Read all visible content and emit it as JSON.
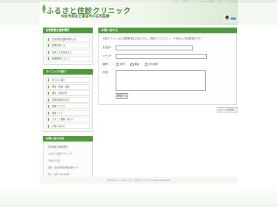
{
  "header": {
    "note": "ふるさと住診クリニックは仙台市泉区と富谷市の在宅医療",
    "title": "ふるさと住診クリニック",
    "subtitle": "仙台市泉区と富谷市の在宅医療",
    "logo_icon": "logo-character-icon"
  },
  "sidebar": {
    "section1": {
      "heading": "在宅療養支援診療所",
      "items": [
        "在宅療養支援診療所とは",
        "訪問診療とは",
        "対象となる患者さん",
        "医療機関について"
      ]
    },
    "section2": {
      "heading": "クリニックの紹介",
      "items": [
        "法人のご紹介",
        "院長・医師・看護",
        "理念・基本方針",
        "訪問診療所の流れ",
        "地図アクセス",
        "関連リンク",
        "スタッフ募集（求人）",
        "お問い合わせ"
      ]
    },
    "section3": {
      "heading": "お問い合わせ先",
      "lines": [
        "在宅療養支援診療所",
        "ふるさと住診クリニック",
        "〒981-3101",
        "住所：仙台市泉区明石南6-4-5",
        "TEL：022-344-0987"
      ]
    }
  },
  "main": {
    "heading": "お問い合わせ",
    "intro": "下記のフォームに必要事項をご記入の上、送信してください。（*印は入力必須項目です）",
    "form": {
      "name_label": "お名前*",
      "email_label": "メール*",
      "type_label": "種別*",
      "options": [
        "質問",
        "要望",
        "資料請求"
      ],
      "content_label": "内容*",
      "submit_label": "確認する"
    }
  },
  "pagetop_label": "▲ページの先頭へ",
  "footer": {
    "copyright": "Copyright © 2016 ふるさと住診クリニック All Rights Reserved."
  },
  "colors": {
    "accent": "#4e9a3a",
    "title": "#3a8a22"
  }
}
